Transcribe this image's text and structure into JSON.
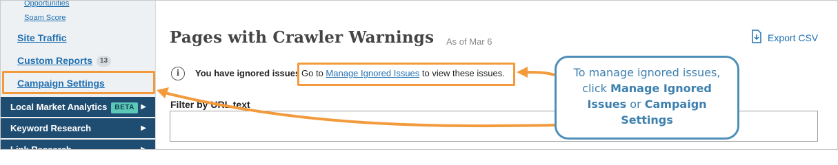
{
  "sidebar": {
    "sub_items": [
      "Opportunities",
      "Spam Score"
    ],
    "site_traffic": "Site Traffic",
    "custom_reports": "Custom Reports",
    "custom_reports_count": "13",
    "campaign_settings": "Campaign Settings",
    "sections": [
      {
        "label": "Local Market Analytics",
        "badge": "BETA"
      },
      {
        "label": "Keyword Research"
      },
      {
        "label": "Link Research"
      }
    ]
  },
  "header": {
    "title": "Pages with Crawler Warnings",
    "as_of": "As of Mar 6",
    "export_label": "Export CSV"
  },
  "notice": {
    "lead": "You have ignored issues.",
    "prefix": "Go to ",
    "link": "Manage Ignored Issues",
    "suffix": " to view these issues."
  },
  "filter": {
    "label": "Filter by URL text",
    "value": ""
  },
  "callout": {
    "line1": "To manage ignored issues,",
    "line2_prefix": "click ",
    "line2_bold": "Manage Ignored",
    "line3_bold": "Issues",
    "line3_mid": " or ",
    "line3_bold2": "Campaign",
    "line4_bold": "Settings"
  },
  "colors": {
    "accent_orange": "#f39b3c",
    "nav_dark": "#1f4d72",
    "link_blue": "#1f6fb0",
    "callout_blue": "#4d8fb8",
    "beta_badge": "#5bc7b6"
  }
}
